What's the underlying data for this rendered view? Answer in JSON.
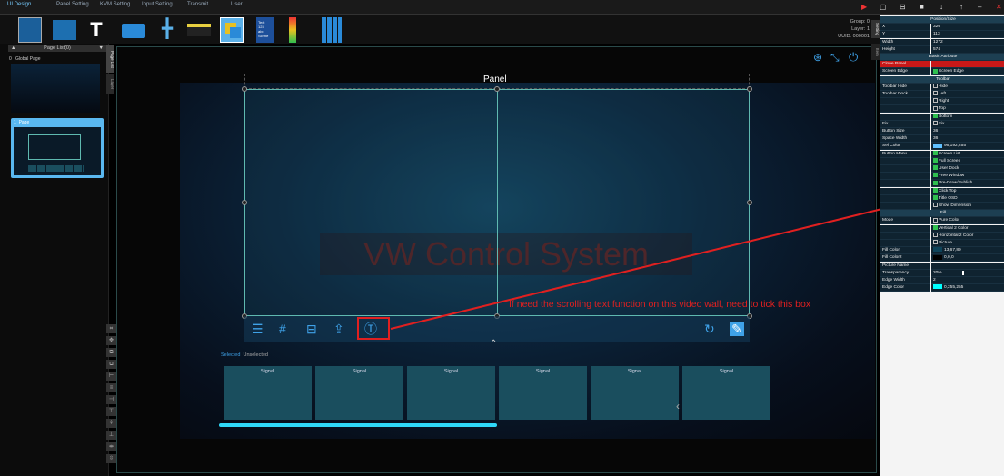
{
  "menu": [
    "UI Design",
    "Panel Setting",
    "KVM Setting",
    "Input Setting",
    "Transmit",
    "User"
  ],
  "toolbar": {
    "icons": [
      "layout-icon",
      "background-icon",
      "text-icon",
      "window-icon",
      "pan-icon",
      "list-icon",
      "layers-icon",
      "clock-scene-icon",
      "level-icon",
      "grid-icon"
    ],
    "clock_text": "Text\n123\nabc\nScene"
  },
  "status": {
    "group": "Group: 0",
    "layer": "Layer: 1",
    "uuid": "UUID: 000001"
  },
  "page_panel": {
    "header": "Page List(0)",
    "items": [
      {
        "index": "0",
        "label": "Global Page"
      },
      {
        "index": "1",
        "label": "Page"
      }
    ],
    "tabs": [
      "Page List",
      "Layer"
    ]
  },
  "canvas": {
    "panel_label": "Panel",
    "watermark": "VW Control System",
    "annotation": "If need the scrolling text function on this video wall, need to tick this box",
    "selected": "Selected",
    "unselected": "Unselected",
    "signals": [
      "Signal",
      "Signal",
      "Signal",
      "Signal",
      "Signal",
      "Signal"
    ]
  },
  "right_panel": {
    "tabs": [
      "Setting",
      "Item"
    ],
    "sections": [
      {
        "title": "Position/Size",
        "rows": [
          [
            "X",
            "326"
          ],
          [
            "Y",
            "113"
          ],
          [
            "Width",
            "1272"
          ],
          [
            "Height",
            "574"
          ]
        ]
      },
      {
        "title": "Basic Attribute",
        "rows": [
          [
            "Clone Panel",
            ""
          ],
          [
            "Screen Edge",
            "Screen Edge"
          ]
        ]
      },
      {
        "title": "Toolbar",
        "rows": [
          [
            "Toolbar Hide",
            "Hide"
          ],
          [
            "Toolbar Dock",
            "Left"
          ],
          [
            "",
            "Right"
          ],
          [
            "",
            "Top"
          ],
          [
            "",
            "Bottom"
          ],
          [
            "Fix",
            "Fix"
          ],
          [
            "Button Size",
            "36"
          ],
          [
            "Space Width",
            "36"
          ],
          [
            "Sel Color",
            "96,192,255"
          ],
          [
            "Button Menu",
            "Screen List"
          ],
          [
            "",
            "Full Screen"
          ],
          [
            "",
            "User Dock"
          ],
          [
            "",
            "Free Window"
          ],
          [
            "",
            "Pre-Draw/Publish"
          ],
          [
            "",
            "Click Top"
          ],
          [
            "",
            "Title OSD"
          ],
          [
            "",
            "Show Dimension"
          ]
        ]
      },
      {
        "title": "Fill",
        "rows": [
          [
            "Mode",
            "Pure Color"
          ],
          [
            "",
            "Vertical 2 Color"
          ],
          [
            "",
            "Horizontal 2 Color"
          ],
          [
            "",
            "Picture"
          ],
          [
            "Fill Color",
            "13,67,89"
          ],
          [
            "Fill Color2",
            "0,0,0"
          ],
          [
            "Picture Name",
            ""
          ],
          [
            "Transparency",
            "20%"
          ],
          [
            "Edge Width",
            "2"
          ],
          [
            "Edge Color",
            "0,255,255"
          ]
        ]
      }
    ],
    "checked": [
      "Screen Edge",
      "Bottom",
      "Screen List",
      "Full Screen",
      "User Dock",
      "Free Window",
      "Pre-Draw/Publish",
      "Click Top",
      "Title OSD"
    ],
    "unchecked": [
      "Hide",
      "Left",
      "Right",
      "Top",
      "Fix",
      "Show Dimension",
      "Pure Color",
      "Horizontal 2 Color",
      "Picture"
    ],
    "checked_fill": [
      "Vertical 2 Color"
    ]
  },
  "colors": {
    "accent": "#3fa2e8",
    "highlight": "#e02020",
    "sel": "#60c0ff",
    "fill": "#0d4359",
    "edge": "#00ffff"
  }
}
